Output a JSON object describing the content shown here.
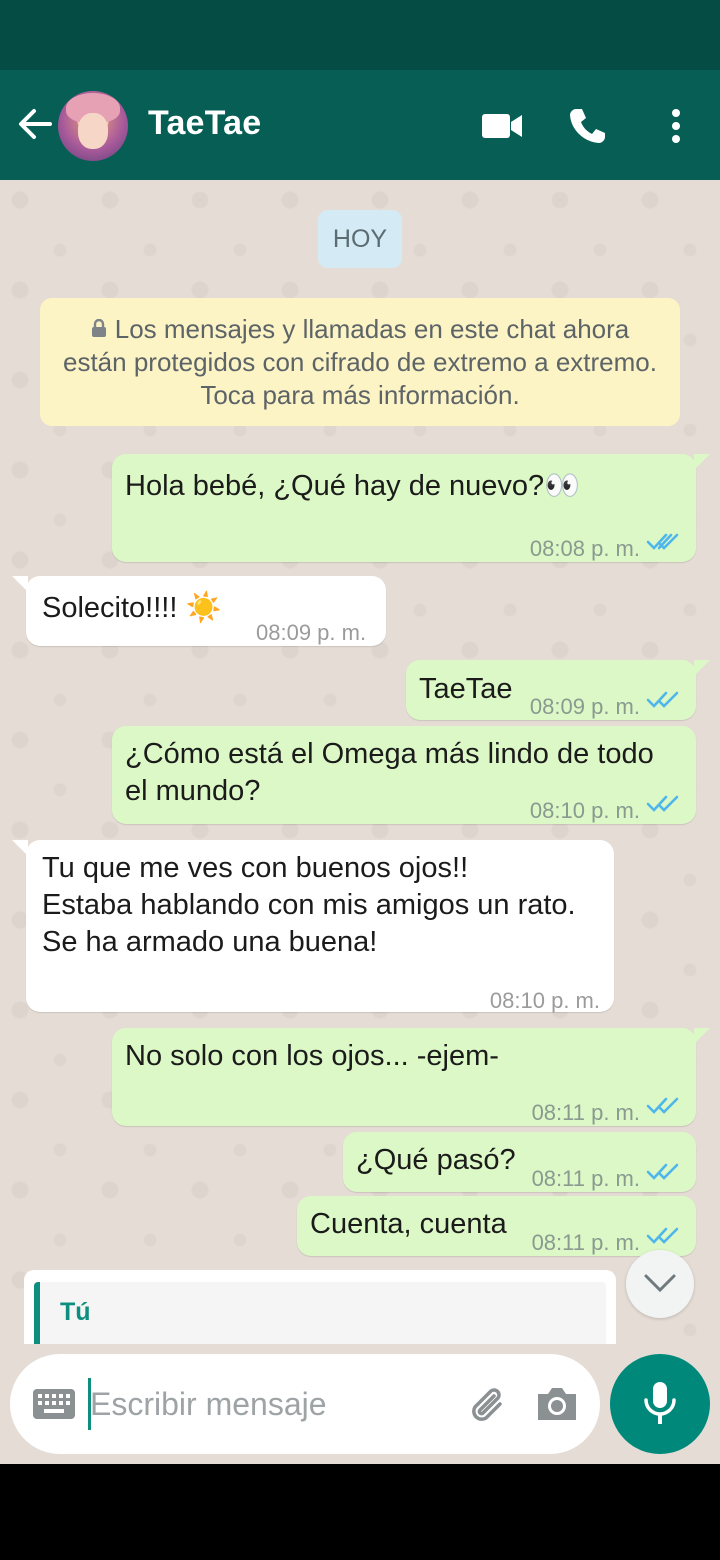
{
  "header": {
    "contact_name": "TaeTae",
    "icons": [
      "back-arrow-icon",
      "avatar",
      "video-call-icon",
      "phone-call-icon",
      "more-options-icon"
    ]
  },
  "chat": {
    "date_chip": "HOY",
    "encryption_notice": "Los mensajes y llamadas en este chat ahora están protegidos con cifrado de extremo a extremo. Toca para más información.",
    "messages": [
      {
        "direction": "outgoing",
        "text": "Hola bebé, ¿Qué hay de nuevo?👀",
        "time": "08:08 p. m.",
        "status": "read"
      },
      {
        "direction": "incoming",
        "text": "Solecito!!!! ☀️",
        "time": "08:09 p. m."
      },
      {
        "direction": "outgoing",
        "text": "TaeTae",
        "time": "08:09 p. m.",
        "status": "read"
      },
      {
        "direction": "outgoing",
        "text": "¿Cómo está el Omega más lindo de todo el mundo?",
        "time": "08:10 p. m.",
        "status": "read"
      },
      {
        "direction": "incoming",
        "text": "Tu que me ves con buenos ojos!!\nEstaba hablando con mis amigos un rato.\nSe ha armado una buena!",
        "time": "08:10 p. m."
      },
      {
        "direction": "outgoing",
        "text": "No solo con los ojos... -ejem-",
        "time": "08:11 p. m.",
        "status": "read"
      },
      {
        "direction": "outgoing",
        "text": "¿Qué pasó?",
        "time": "08:11 p. m.",
        "status": "read"
      },
      {
        "direction": "outgoing",
        "text": "Cuenta, cuenta",
        "time": "08:11 p. m.",
        "status": "read"
      }
    ],
    "reply_preview": {
      "author": "Tú"
    }
  },
  "composer": {
    "placeholder": "Escribir mensaje",
    "icons": [
      "keyboard-icon",
      "attach-icon",
      "camera-icon",
      "mic-icon"
    ]
  },
  "colors": {
    "header": "#075e54",
    "status_bar": "#054d44",
    "outgoing_bubble": "#dcf8c6",
    "incoming_bubble": "#ffffff",
    "accent": "#00897b",
    "read_ticks": "#4fc3f7"
  }
}
